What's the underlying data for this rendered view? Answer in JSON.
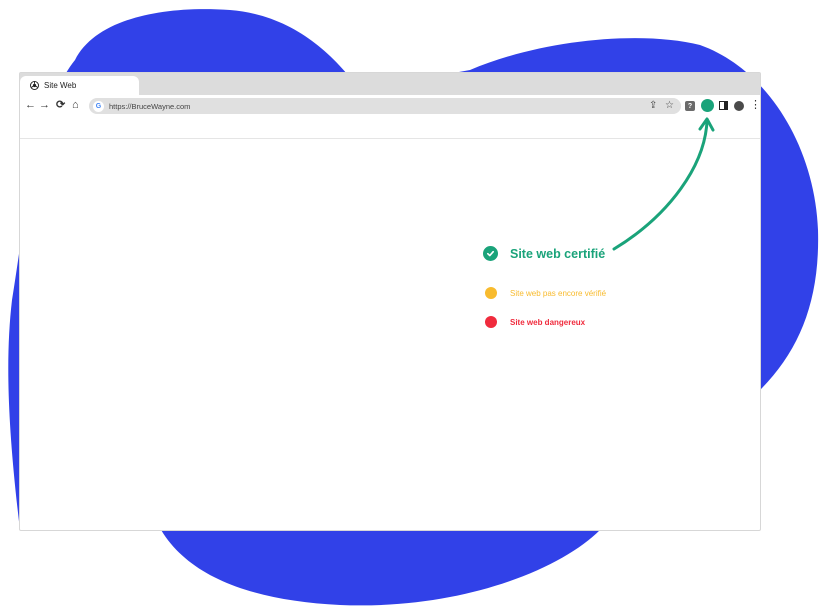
{
  "colors": {
    "background_blob": "#3141e8",
    "certified": "#1aa37a",
    "pending": "#f8bb2e",
    "danger": "#f02b3d",
    "tabstrip": "#dcdcdc",
    "urlbar": "#e0e0e0"
  },
  "browser": {
    "tab_title": "Site Web",
    "tab_icon": "chrome-logo-icon",
    "nav": {
      "back": "←",
      "forward": "→",
      "reload": "⟳",
      "home": "⌂"
    },
    "address_bar": {
      "site_icon": "G",
      "url": "https://BruceWayne.com",
      "share_icon": "⇪",
      "bookmark_icon": "☆"
    },
    "extensions": {
      "puzzle_label": "?",
      "status_icon": "green-circle-icon",
      "side_panel_icon": "side-panel-icon",
      "profile_icon": "avatar-icon",
      "menu": "⋮"
    }
  },
  "legend": {
    "certified": "Site web certifié",
    "pending": "Site web pas encore vérifié",
    "danger": "Site web dangereux"
  }
}
